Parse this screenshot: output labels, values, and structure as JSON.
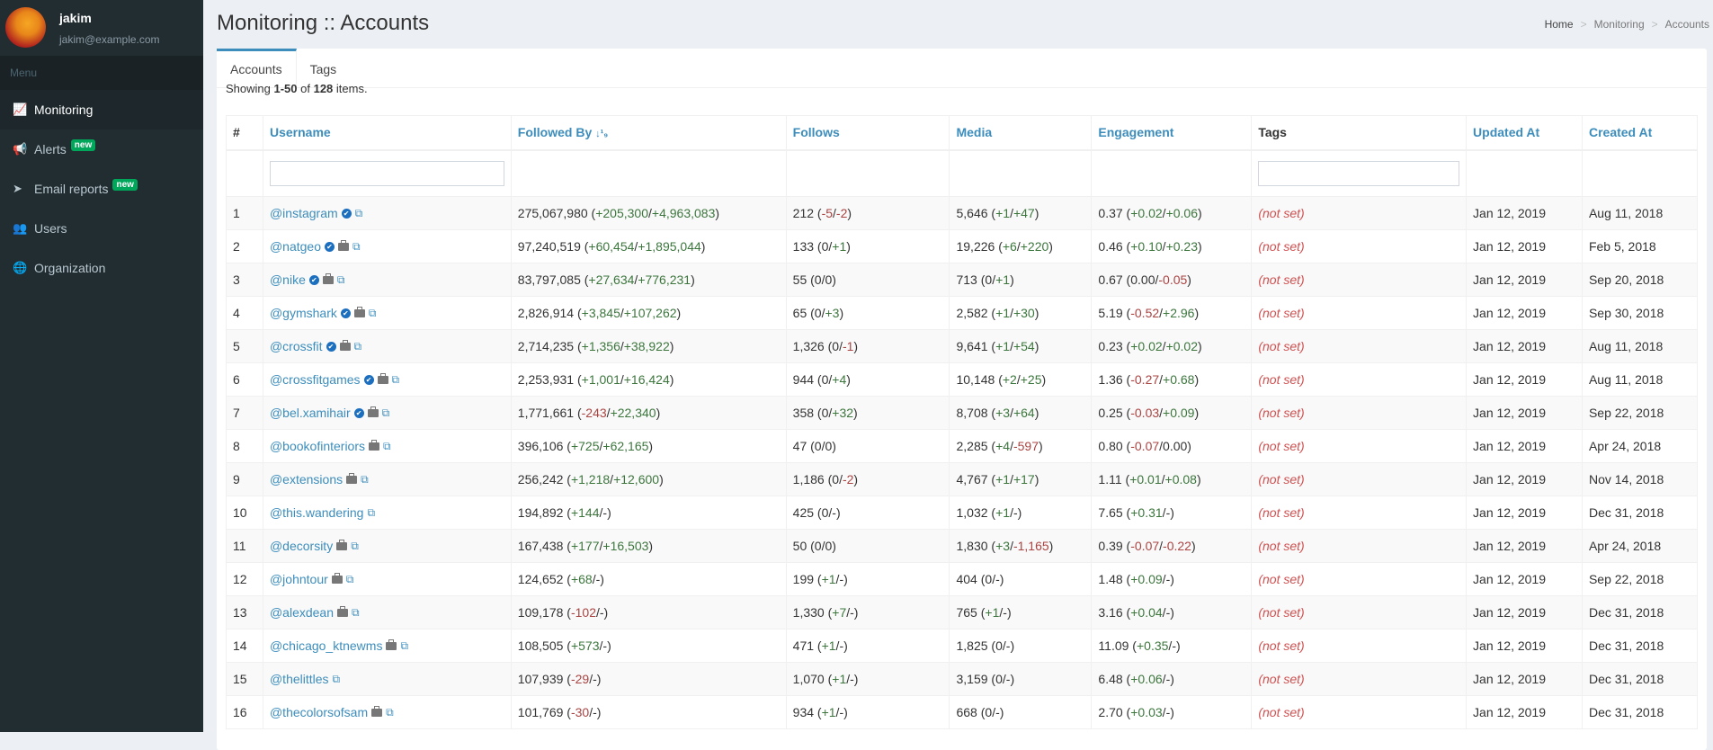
{
  "user": {
    "name": "jakim",
    "email": "jakim@example.com"
  },
  "sidebar": {
    "menu_header": "Menu",
    "items": [
      {
        "label": "Monitoring",
        "icon": "line-chart-icon",
        "glyph": "📈",
        "active": true
      },
      {
        "label": "Alerts",
        "icon": "bullhorn-icon",
        "glyph": "📢",
        "badge": "new"
      },
      {
        "label": "Email reports",
        "icon": "paper-plane-icon",
        "glyph": "➤",
        "badge": "new"
      },
      {
        "label": "Users",
        "icon": "users-icon",
        "glyph": "👥"
      },
      {
        "label": "Organization",
        "icon": "globe-icon",
        "glyph": "🌐"
      }
    ]
  },
  "header": {
    "title": "Monitoring :: Accounts",
    "breadcrumb": [
      "Home",
      "Monitoring",
      "Accounts"
    ]
  },
  "tabs": [
    "Accounts",
    "Tags"
  ],
  "summary": {
    "prefix": "Showing ",
    "range": "1-50",
    "mid": " of ",
    "total": "128",
    "suffix": " items."
  },
  "columns": [
    "#",
    "Username",
    "Followed By",
    "Follows",
    "Media",
    "Engagement",
    "Tags",
    "Updated At",
    "Created At"
  ],
  "sort_indicator": "↓¹₉",
  "not_set": "(not set)",
  "colors": {
    "accent": "#3c8dbc",
    "positive": "#3c763d",
    "negative": "#a94442",
    "sidebar": "#222d32"
  },
  "rows": [
    {
      "n": "1",
      "user": "@instagram",
      "verified": true,
      "business": false,
      "followed": [
        "275,067,980",
        "+205,300",
        "+4,963,083"
      ],
      "follows": [
        "212",
        "-5",
        "-2"
      ],
      "media": [
        "5,646",
        "+1",
        "+47"
      ],
      "eng": [
        "0.37",
        "+0.02",
        "+0.06"
      ],
      "updated": "Jan 12, 2019",
      "created": "Aug 11, 2018"
    },
    {
      "n": "2",
      "user": "@natgeo",
      "verified": true,
      "business": true,
      "followed": [
        "97,240,519",
        "+60,454",
        "+1,895,044"
      ],
      "follows": [
        "133",
        "0",
        "+1"
      ],
      "media": [
        "19,226",
        "+6",
        "+220"
      ],
      "eng": [
        "0.46",
        "+0.10",
        "+0.23"
      ],
      "updated": "Jan 12, 2019",
      "created": "Feb 5, 2018"
    },
    {
      "n": "3",
      "user": "@nike",
      "verified": true,
      "business": true,
      "followed": [
        "83,797,085",
        "+27,634",
        "+776,231"
      ],
      "follows": [
        "55",
        "0",
        "0"
      ],
      "media": [
        "713",
        "0",
        "+1"
      ],
      "eng": [
        "0.67",
        "0.00",
        "-0.05"
      ],
      "updated": "Jan 12, 2019",
      "created": "Sep 20, 2018"
    },
    {
      "n": "4",
      "user": "@gymshark",
      "verified": true,
      "business": true,
      "followed": [
        "2,826,914",
        "+3,845",
        "+107,262"
      ],
      "follows": [
        "65",
        "0",
        "+3"
      ],
      "media": [
        "2,582",
        "+1",
        "+30"
      ],
      "eng": [
        "5.19",
        "-0.52",
        "+2.96"
      ],
      "updated": "Jan 12, 2019",
      "created": "Sep 30, 2018"
    },
    {
      "n": "5",
      "user": "@crossfit",
      "verified": true,
      "business": true,
      "followed": [
        "2,714,235",
        "+1,356",
        "+38,922"
      ],
      "follows": [
        "1,326",
        "0",
        "-1"
      ],
      "media": [
        "9,641",
        "+1",
        "+54"
      ],
      "eng": [
        "0.23",
        "+0.02",
        "+0.02"
      ],
      "updated": "Jan 12, 2019",
      "created": "Aug 11, 2018"
    },
    {
      "n": "6",
      "user": "@crossfitgames",
      "verified": true,
      "business": true,
      "followed": [
        "2,253,931",
        "+1,001",
        "+16,424"
      ],
      "follows": [
        "944",
        "0",
        "+4"
      ],
      "media": [
        "10,148",
        "+2",
        "+25"
      ],
      "eng": [
        "1.36",
        "-0.27",
        "+0.68"
      ],
      "updated": "Jan 12, 2019",
      "created": "Aug 11, 2018"
    },
    {
      "n": "7",
      "user": "@bel.xamihair",
      "verified": true,
      "business": true,
      "followed": [
        "1,771,661",
        "-243",
        "+22,340"
      ],
      "follows": [
        "358",
        "0",
        "+32"
      ],
      "media": [
        "8,708",
        "+3",
        "+64"
      ],
      "eng": [
        "0.25",
        "-0.03",
        "+0.09"
      ],
      "updated": "Jan 12, 2019",
      "created": "Sep 22, 2018"
    },
    {
      "n": "8",
      "user": "@bookofinteriors",
      "verified": false,
      "business": true,
      "followed": [
        "396,106",
        "+725",
        "+62,165"
      ],
      "follows": [
        "47",
        "0",
        "0"
      ],
      "media": [
        "2,285",
        "+4",
        "-597"
      ],
      "eng": [
        "0.80",
        "-0.07",
        "0.00"
      ],
      "updated": "Jan 12, 2019",
      "created": "Apr 24, 2018"
    },
    {
      "n": "9",
      "user": "@extensions",
      "verified": false,
      "business": true,
      "followed": [
        "256,242",
        "+1,218",
        "+12,600"
      ],
      "follows": [
        "1,186",
        "0",
        "-2"
      ],
      "media": [
        "4,767",
        "+1",
        "+17"
      ],
      "eng": [
        "1.11",
        "+0.01",
        "+0.08"
      ],
      "updated": "Jan 12, 2019",
      "created": "Nov 14, 2018"
    },
    {
      "n": "10",
      "user": "@this.wandering",
      "verified": false,
      "business": false,
      "followed": [
        "194,892",
        "+144",
        "-"
      ],
      "follows": [
        "425",
        "0",
        "-"
      ],
      "media": [
        "1,032",
        "+1",
        "-"
      ],
      "eng": [
        "7.65",
        "+0.31",
        "-"
      ],
      "updated": "Jan 12, 2019",
      "created": "Dec 31, 2018"
    },
    {
      "n": "11",
      "user": "@decorsity",
      "verified": false,
      "business": true,
      "followed": [
        "167,438",
        "+177",
        "+16,503"
      ],
      "follows": [
        "50",
        "0",
        "0"
      ],
      "media": [
        "1,830",
        "+3",
        "-1,165"
      ],
      "eng": [
        "0.39",
        "-0.07",
        "-0.22"
      ],
      "updated": "Jan 12, 2019",
      "created": "Apr 24, 2018"
    },
    {
      "n": "12",
      "user": "@johntour",
      "verified": false,
      "business": true,
      "followed": [
        "124,652",
        "+68",
        "-"
      ],
      "follows": [
        "199",
        "+1",
        "-"
      ],
      "media": [
        "404",
        "0",
        "-"
      ],
      "eng": [
        "1.48",
        "+0.09",
        "-"
      ],
      "updated": "Jan 12, 2019",
      "created": "Sep 22, 2018"
    },
    {
      "n": "13",
      "user": "@alexdean",
      "verified": false,
      "business": true,
      "followed": [
        "109,178",
        "-102",
        "-"
      ],
      "follows": [
        "1,330",
        "+7",
        "-"
      ],
      "media": [
        "765",
        "+1",
        "-"
      ],
      "eng": [
        "3.16",
        "+0.04",
        "-"
      ],
      "updated": "Jan 12, 2019",
      "created": "Dec 31, 2018"
    },
    {
      "n": "14",
      "user": "@chicago_ktnewms",
      "verified": false,
      "business": true,
      "followed": [
        "108,505",
        "+573",
        "-"
      ],
      "follows": [
        "471",
        "+1",
        "-"
      ],
      "media": [
        "1,825",
        "0",
        "-"
      ],
      "eng": [
        "11.09",
        "+0.35",
        "-"
      ],
      "updated": "Jan 12, 2019",
      "created": "Dec 31, 2018"
    },
    {
      "n": "15",
      "user": "@thelittles",
      "verified": false,
      "business": false,
      "followed": [
        "107,939",
        "-29",
        "-"
      ],
      "follows": [
        "1,070",
        "+1",
        "-"
      ],
      "media": [
        "3,159",
        "0",
        "-"
      ],
      "eng": [
        "6.48",
        "+0.06",
        "-"
      ],
      "updated": "Jan 12, 2019",
      "created": "Dec 31, 2018"
    },
    {
      "n": "16",
      "user": "@thecolorsofsam",
      "verified": false,
      "business": true,
      "followed": [
        "101,769",
        "-30",
        "-"
      ],
      "follows": [
        "934",
        "+1",
        "-"
      ],
      "media": [
        "668",
        "0",
        "-"
      ],
      "eng": [
        "2.70",
        "+0.03",
        "-"
      ],
      "updated": "Jan 12, 2019",
      "created": "Dec 31, 2018"
    }
  ]
}
